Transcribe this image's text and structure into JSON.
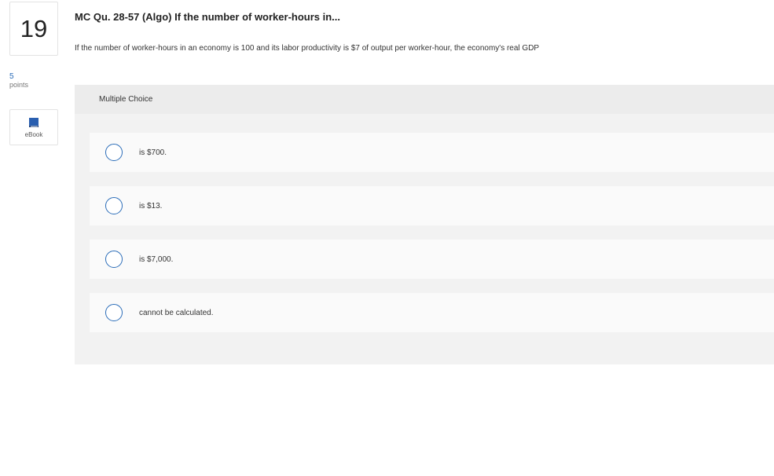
{
  "question": {
    "number": "19",
    "points_value": "5",
    "points_label": "points",
    "ebook_label": "eBook",
    "title": "MC Qu. 28-57 (Algo) If the number of worker-hours in...",
    "text": "If the number of worker-hours in an economy is 100 and its labor productivity is $7 of output per worker-hour, the economy's real GDP"
  },
  "answer_panel": {
    "header": "Multiple Choice",
    "options": [
      {
        "label": "is $700."
      },
      {
        "label": "is $13."
      },
      {
        "label": "is $7,000."
      },
      {
        "label": "cannot be calculated."
      }
    ]
  },
  "colors": {
    "accent": "#2a6cb8",
    "panel_bg": "#f2f2f2",
    "option_bg": "#fafafa"
  },
  "icons": {
    "ebook": "book-icon",
    "option_radio": "radio-circle-icon"
  }
}
